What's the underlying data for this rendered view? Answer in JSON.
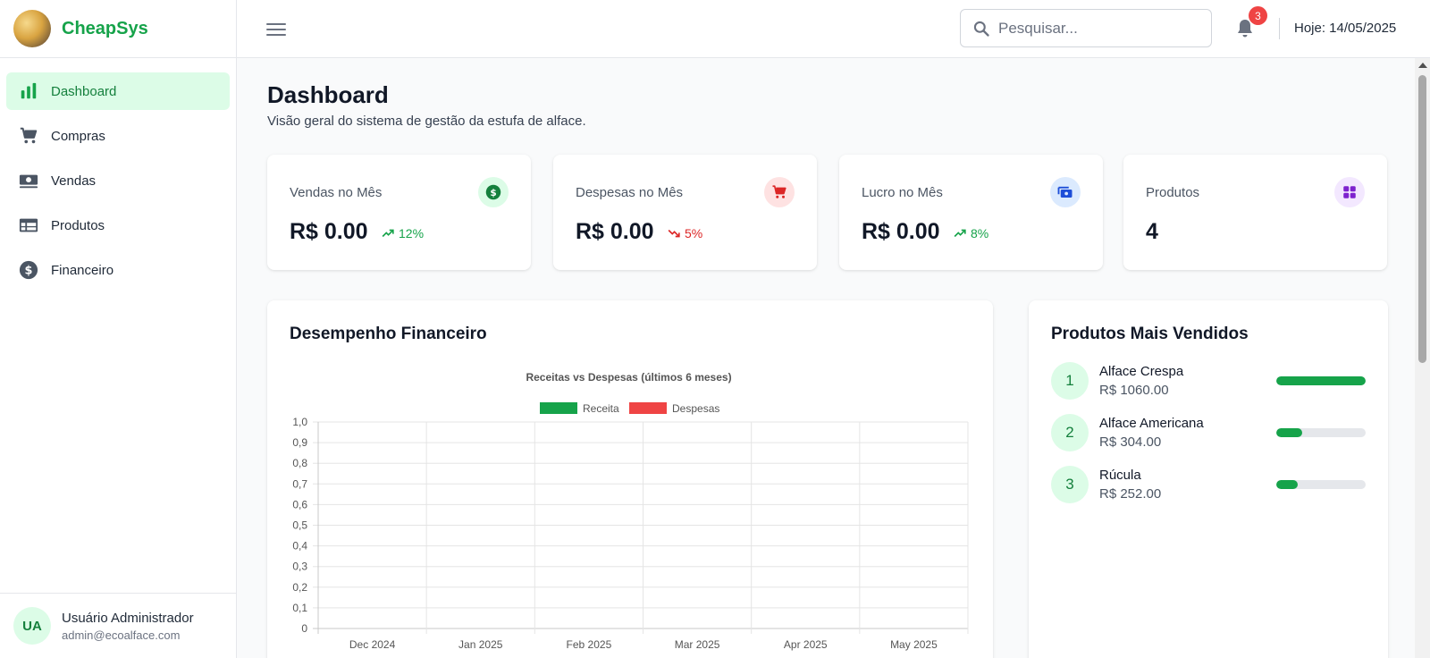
{
  "brand": {
    "name": "CheapSys"
  },
  "sidebar": {
    "items": [
      {
        "label": "Dashboard",
        "icon": "bar-chart-icon",
        "active": true
      },
      {
        "label": "Compras",
        "icon": "cart-icon"
      },
      {
        "label": "Vendas",
        "icon": "cash-icon"
      },
      {
        "label": "Produtos",
        "icon": "table-icon"
      },
      {
        "label": "Financeiro",
        "icon": "dollar-circle-icon"
      }
    ]
  },
  "user": {
    "initials": "UA",
    "name": "Usuário Administrador",
    "email": "admin@ecoalface.com"
  },
  "header": {
    "search_placeholder": "Pesquisar...",
    "notifications_count": "3",
    "today": "Hoje: 14/05/2025"
  },
  "page": {
    "title": "Dashboard",
    "subtitle": "Visão geral do sistema de gestão da estufa de alface."
  },
  "stats": [
    {
      "label": "Vendas no Mês",
      "value": "R$ 0.00",
      "trend": "12%",
      "trend_dir": "up",
      "icon": "dollar-icon"
    },
    {
      "label": "Despesas no Mês",
      "value": "R$ 0.00",
      "trend": "5%",
      "trend_dir": "down",
      "icon": "cart-icon"
    },
    {
      "label": "Lucro no Mês",
      "value": "R$ 0.00",
      "trend": "8%",
      "trend_dir": "up",
      "icon": "wallet-icon"
    },
    {
      "label": "Produtos",
      "value": "4",
      "icon": "grid-icon"
    }
  ],
  "colors": {
    "accent": "#16a34a",
    "receita": "#16a34a",
    "despesas": "#ef4444",
    "danger": "#dc2626"
  },
  "financial_panel": {
    "title": "Desempenho Financeiro"
  },
  "chart_data": {
    "type": "bar",
    "title": "Receitas vs Despesas (últimos 6 meses)",
    "categories": [
      "Dec 2024",
      "Jan 2025",
      "Feb 2025",
      "Mar 2025",
      "Apr 2025",
      "May 2025"
    ],
    "series": [
      {
        "name": "Receita",
        "values": [
          0,
          0,
          0,
          0,
          0,
          0
        ]
      },
      {
        "name": "Despesas",
        "values": [
          0,
          0,
          0,
          0,
          0,
          0
        ]
      }
    ],
    "ylim": [
      0,
      1
    ],
    "yticks": [
      "0",
      "0,1",
      "0,2",
      "0,3",
      "0,4",
      "0,5",
      "0,6",
      "0,7",
      "0,8",
      "0,9",
      "1,0"
    ],
    "legend": "top",
    "grid": true
  },
  "top_products": {
    "title": "Produtos Mais Vendidos",
    "items": [
      {
        "rank": "1",
        "name": "Alface Crespa",
        "value": "R$ 1060.00",
        "share": 1.0
      },
      {
        "rank": "2",
        "name": "Alface Americana",
        "value": "R$ 304.00",
        "share": 0.287
      },
      {
        "rank": "3",
        "name": "Rúcula",
        "value": "R$ 252.00",
        "share": 0.238
      }
    ]
  }
}
